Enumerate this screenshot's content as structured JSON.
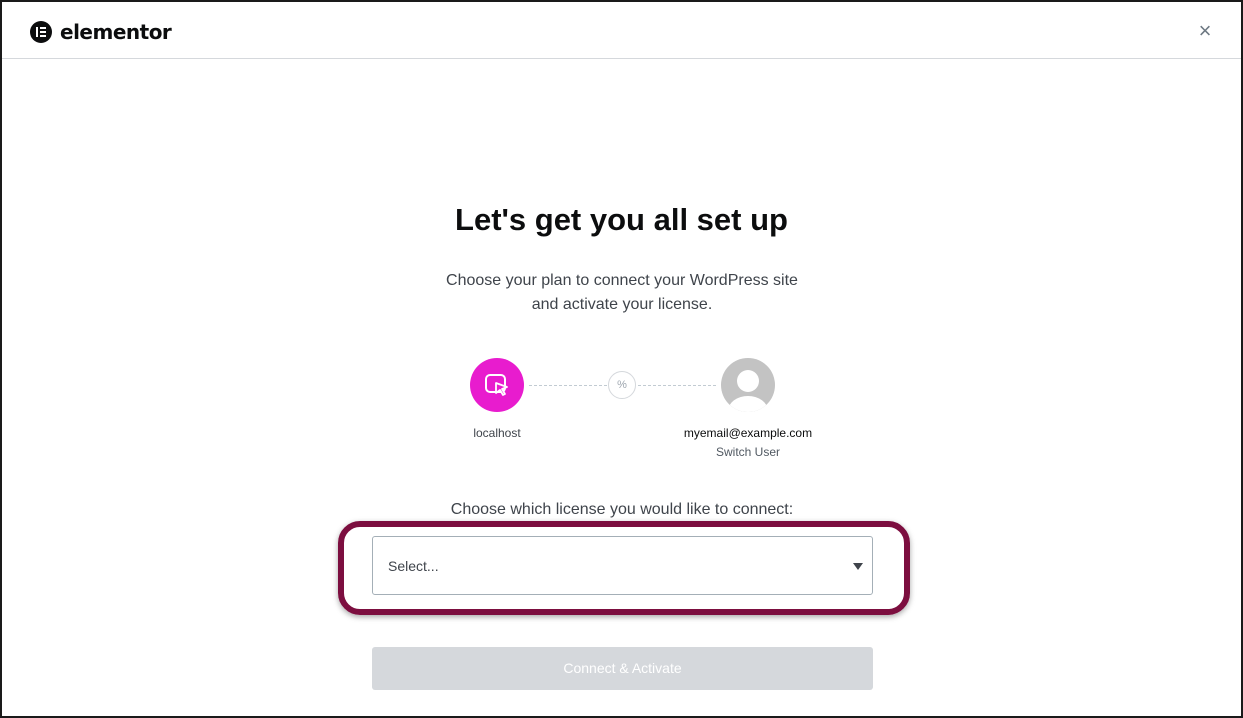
{
  "header": {
    "logo_text": "elementor",
    "close_glyph": "×"
  },
  "main": {
    "title": "Let's get you all set up",
    "subtitle_line1": "Choose your plan to connect your WordPress site",
    "subtitle_line2": "and activate your license.",
    "site_label": "localhost",
    "link_glyph": "%",
    "user_email": "myemail@example.com",
    "switch_user_label": "Switch User",
    "license_prompt": "Choose which license you would like to connect:",
    "license_select": {
      "value": "Select..."
    },
    "connect_button_label": "Connect & Activate"
  },
  "colors": {
    "site_icon_bg": "#e81cce",
    "highlight_border": "#7c0e3f",
    "button_disabled_bg": "#d5d8dc"
  },
  "icons": {
    "logo": "elementor-logo-icon",
    "close": "close-icon",
    "site": "cursor-click-icon",
    "link": "link-icon",
    "avatar": "user-avatar-icon",
    "caret": "caret-down-icon"
  }
}
